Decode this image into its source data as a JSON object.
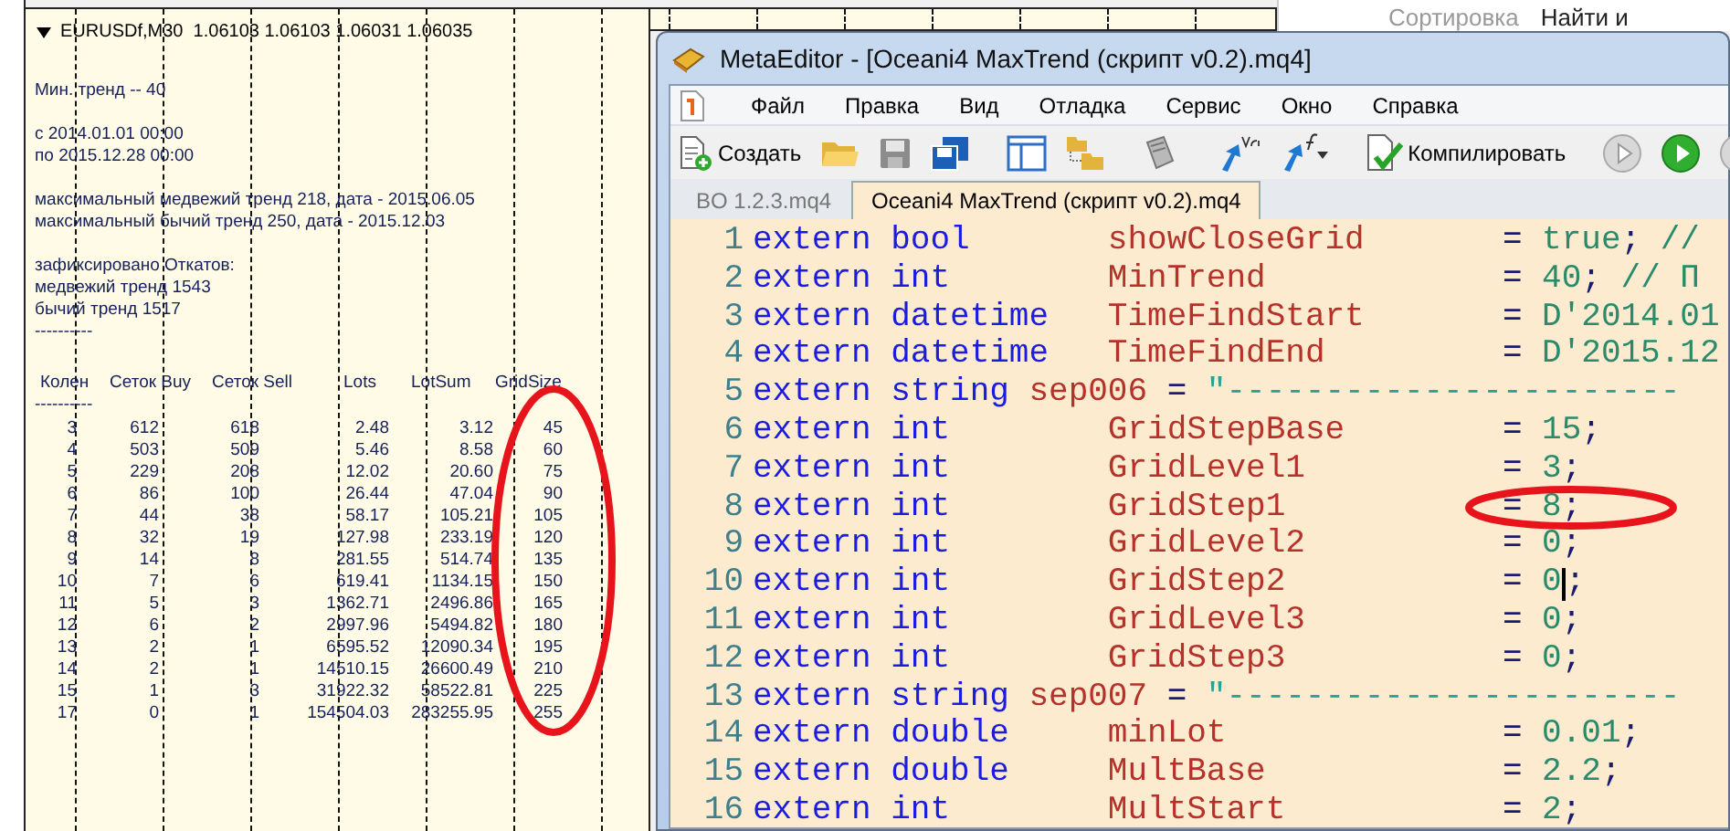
{
  "background_ribbon": {
    "items": [
      {
        "label": "Сортировка",
        "disabled": true
      },
      {
        "label": "Найти и",
        "disabled": false
      }
    ]
  },
  "chart": {
    "header": "EURUSDf,M30  1.06103 1.06103 1.06031 1.06035",
    "blocks": [
      [
        "Мин. тренд -- 40"
      ],
      [
        "с 2014.01.01 00:00",
        "по 2015.12.28 00:00"
      ],
      [
        "максимальный медвежий тренд 218, дата - 2015.06.05",
        "максимальный бычий тренд 250, дата - 2015.12.03"
      ],
      [
        "зафиксировано Откатов:",
        "медвежий тренд 1543",
        "бычий тренд 1517",
        "----------"
      ]
    ],
    "table": {
      "columns": [
        {
          "label": "Колен",
          "circled": false
        },
        {
          "label": "Сеток Buy",
          "circled": false
        },
        {
          "label": "Сеток Sell",
          "circled": false
        },
        {
          "label": "Lots",
          "circled": false
        },
        {
          "label": "LotSum",
          "circled": false
        },
        {
          "label": "GridSize",
          "circled": true
        }
      ],
      "header_rule": "----------",
      "rows": [
        [
          "3",
          "612",
          "618",
          "2.48",
          "3.12",
          "45"
        ],
        [
          "4",
          "503",
          "509",
          "5.46",
          "8.58",
          "60"
        ],
        [
          "5",
          "229",
          "208",
          "12.02",
          "20.60",
          "75"
        ],
        [
          "6",
          "86",
          "100",
          "26.44",
          "47.04",
          "90"
        ],
        [
          "7",
          "44",
          "38",
          "58.17",
          "105.21",
          "105"
        ],
        [
          "8",
          "32",
          "19",
          "127.98",
          "233.19",
          "120"
        ],
        [
          "9",
          "14",
          "8",
          "281.55",
          "514.74",
          "135"
        ],
        [
          "10",
          "7",
          "6",
          "619.41",
          "1134.15",
          "150"
        ],
        [
          "11",
          "5",
          "3",
          "1362.71",
          "2496.86",
          "165"
        ],
        [
          "12",
          "6",
          "2",
          "2997.96",
          "5494.82",
          "180"
        ],
        [
          "13",
          "2",
          "1",
          "6595.52",
          "12090.34",
          "195"
        ],
        [
          "14",
          "2",
          "1",
          "14510.15",
          "26600.49",
          "210"
        ],
        [
          "15",
          "1",
          "3",
          "31922.32",
          "58522.81",
          "225"
        ],
        [
          "17",
          "0",
          "1",
          "154504.03",
          "283255.95",
          "255"
        ]
      ]
    }
  },
  "editor": {
    "title": "MetaEditor - [Oceani4 MaxTrend (скрипт v0.2).mq4]",
    "menu": [
      "Файл",
      "Правка",
      "Вид",
      "Отладка",
      "Сервис",
      "Окно",
      "Справка"
    ],
    "toolbar": {
      "create": "Создать",
      "compile": "Компилировать"
    },
    "tabs": [
      {
        "label": "BO 1.2.3.mq4",
        "selected": false
      },
      {
        "label": "Oceani4 MaxTrend (скрипт v0.2).mq4",
        "selected": true
      }
    ],
    "lines": [
      {
        "number": "1",
        "kind": "param",
        "keyword": "extern",
        "type": "bool",
        "name": "showCloseGrid",
        "op": "=",
        "value": "true",
        "punct": ";",
        "comment": "//",
        "circled": false,
        "cursor": false
      },
      {
        "number": "2",
        "kind": "param",
        "keyword": "extern",
        "type": "int",
        "name": "MinTrend",
        "op": "=",
        "value": "40",
        "punct": ";",
        "comment": "// П",
        "circled": false,
        "cursor": false
      },
      {
        "number": "3",
        "kind": "param",
        "keyword": "extern",
        "type": "datetime",
        "name": "TimeFindStart",
        "op": "=",
        "value": "D'2014.01",
        "circled": false,
        "cursor": false
      },
      {
        "number": "4",
        "kind": "param",
        "keyword": "extern",
        "type": "datetime",
        "name": "TimeFindEnd",
        "op": "=",
        "value": "D'2015.12",
        "circled": false,
        "cursor": false
      },
      {
        "number": "5",
        "kind": "separator",
        "keyword": "extern",
        "type": "string",
        "name": "sep006",
        "op": "=",
        "value": "\"-----------------------",
        "circled": false,
        "cursor": false
      },
      {
        "number": "6",
        "kind": "param",
        "keyword": "extern",
        "type": "int",
        "name": "GridStepBase",
        "op": "=",
        "value": "15",
        "punct": ";",
        "circled": false,
        "cursor": false
      },
      {
        "number": "7",
        "kind": "param",
        "keyword": "extern",
        "type": "int",
        "name": "GridLevel1",
        "op": "=",
        "value": "3",
        "punct": ";",
        "circled": false,
        "cursor": false
      },
      {
        "number": "8",
        "kind": "param",
        "keyword": "extern",
        "type": "int",
        "name": "GridStep1",
        "op": "=",
        "value": "8",
        "punct": ";",
        "circled": true,
        "cursor": false
      },
      {
        "number": "9",
        "kind": "param",
        "keyword": "extern",
        "type": "int",
        "name": "GridLevel2",
        "op": "=",
        "value": "0",
        "punct": ";",
        "circled": false,
        "cursor": false
      },
      {
        "number": "10",
        "kind": "param",
        "keyword": "extern",
        "type": "int",
        "name": "GridStep2",
        "op": "=",
        "value": "0",
        "punct": ";",
        "circled": false,
        "cursor": true
      },
      {
        "number": "11",
        "kind": "param",
        "keyword": "extern",
        "type": "int",
        "name": "GridLevel3",
        "op": "=",
        "value": "0",
        "punct": ";",
        "circled": false,
        "cursor": false
      },
      {
        "number": "12",
        "kind": "param",
        "keyword": "extern",
        "type": "int",
        "name": "GridStep3",
        "op": "=",
        "value": "0",
        "punct": ";",
        "circled": false,
        "cursor": false
      },
      {
        "number": "13",
        "kind": "separator",
        "keyword": "extern",
        "type": "string",
        "name": "sep007",
        "op": "=",
        "value": "\"-----------------------",
        "circled": false,
        "cursor": false
      },
      {
        "number": "14",
        "kind": "param",
        "keyword": "extern",
        "type": "double",
        "name": "minLot",
        "op": "=",
        "value": "0.01",
        "punct": ";",
        "circled": false,
        "cursor": false
      },
      {
        "number": "15",
        "kind": "param",
        "keyword": "extern",
        "type": "double",
        "name": "MultBase",
        "op": "=",
        "value": "2.2",
        "punct": ";",
        "circled": false,
        "cursor": false
      },
      {
        "number": "16",
        "kind": "param",
        "keyword": "extern",
        "type": "int",
        "name": "MultStart",
        "op": "=",
        "value": "2",
        "punct": ";",
        "circled": false,
        "cursor": false
      }
    ]
  }
}
